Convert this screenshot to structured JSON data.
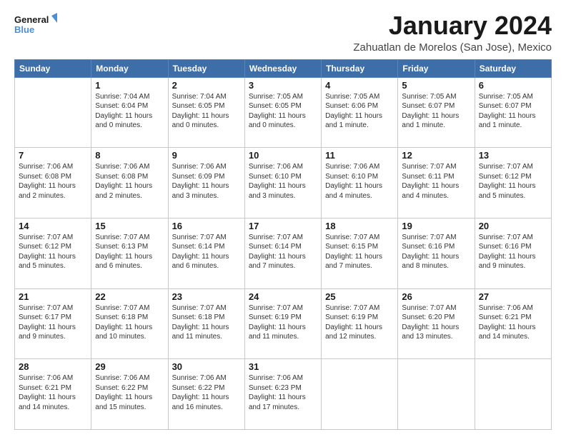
{
  "logo": {
    "line1": "General",
    "line2": "Blue"
  },
  "title": "January 2024",
  "subtitle": "Zahuatlan de Morelos (San Jose), Mexico",
  "days_header": [
    "Sunday",
    "Monday",
    "Tuesday",
    "Wednesday",
    "Thursday",
    "Friday",
    "Saturday"
  ],
  "weeks": [
    [
      {
        "num": "",
        "info": ""
      },
      {
        "num": "1",
        "info": "Sunrise: 7:04 AM\nSunset: 6:04 PM\nDaylight: 11 hours\nand 0 minutes."
      },
      {
        "num": "2",
        "info": "Sunrise: 7:04 AM\nSunset: 6:05 PM\nDaylight: 11 hours\nand 0 minutes."
      },
      {
        "num": "3",
        "info": "Sunrise: 7:05 AM\nSunset: 6:05 PM\nDaylight: 11 hours\nand 0 minutes."
      },
      {
        "num": "4",
        "info": "Sunrise: 7:05 AM\nSunset: 6:06 PM\nDaylight: 11 hours\nand 1 minute."
      },
      {
        "num": "5",
        "info": "Sunrise: 7:05 AM\nSunset: 6:07 PM\nDaylight: 11 hours\nand 1 minute."
      },
      {
        "num": "6",
        "info": "Sunrise: 7:05 AM\nSunset: 6:07 PM\nDaylight: 11 hours\nand 1 minute."
      }
    ],
    [
      {
        "num": "7",
        "info": "Sunrise: 7:06 AM\nSunset: 6:08 PM\nDaylight: 11 hours\nand 2 minutes."
      },
      {
        "num": "8",
        "info": "Sunrise: 7:06 AM\nSunset: 6:08 PM\nDaylight: 11 hours\nand 2 minutes."
      },
      {
        "num": "9",
        "info": "Sunrise: 7:06 AM\nSunset: 6:09 PM\nDaylight: 11 hours\nand 3 minutes."
      },
      {
        "num": "10",
        "info": "Sunrise: 7:06 AM\nSunset: 6:10 PM\nDaylight: 11 hours\nand 3 minutes."
      },
      {
        "num": "11",
        "info": "Sunrise: 7:06 AM\nSunset: 6:10 PM\nDaylight: 11 hours\nand 4 minutes."
      },
      {
        "num": "12",
        "info": "Sunrise: 7:07 AM\nSunset: 6:11 PM\nDaylight: 11 hours\nand 4 minutes."
      },
      {
        "num": "13",
        "info": "Sunrise: 7:07 AM\nSunset: 6:12 PM\nDaylight: 11 hours\nand 5 minutes."
      }
    ],
    [
      {
        "num": "14",
        "info": "Sunrise: 7:07 AM\nSunset: 6:12 PM\nDaylight: 11 hours\nand 5 minutes."
      },
      {
        "num": "15",
        "info": "Sunrise: 7:07 AM\nSunset: 6:13 PM\nDaylight: 11 hours\nand 6 minutes."
      },
      {
        "num": "16",
        "info": "Sunrise: 7:07 AM\nSunset: 6:14 PM\nDaylight: 11 hours\nand 6 minutes."
      },
      {
        "num": "17",
        "info": "Sunrise: 7:07 AM\nSunset: 6:14 PM\nDaylight: 11 hours\nand 7 minutes."
      },
      {
        "num": "18",
        "info": "Sunrise: 7:07 AM\nSunset: 6:15 PM\nDaylight: 11 hours\nand 7 minutes."
      },
      {
        "num": "19",
        "info": "Sunrise: 7:07 AM\nSunset: 6:16 PM\nDaylight: 11 hours\nand 8 minutes."
      },
      {
        "num": "20",
        "info": "Sunrise: 7:07 AM\nSunset: 6:16 PM\nDaylight: 11 hours\nand 9 minutes."
      }
    ],
    [
      {
        "num": "21",
        "info": "Sunrise: 7:07 AM\nSunset: 6:17 PM\nDaylight: 11 hours\nand 9 minutes."
      },
      {
        "num": "22",
        "info": "Sunrise: 7:07 AM\nSunset: 6:18 PM\nDaylight: 11 hours\nand 10 minutes."
      },
      {
        "num": "23",
        "info": "Sunrise: 7:07 AM\nSunset: 6:18 PM\nDaylight: 11 hours\nand 11 minutes."
      },
      {
        "num": "24",
        "info": "Sunrise: 7:07 AM\nSunset: 6:19 PM\nDaylight: 11 hours\nand 11 minutes."
      },
      {
        "num": "25",
        "info": "Sunrise: 7:07 AM\nSunset: 6:19 PM\nDaylight: 11 hours\nand 12 minutes."
      },
      {
        "num": "26",
        "info": "Sunrise: 7:07 AM\nSunset: 6:20 PM\nDaylight: 11 hours\nand 13 minutes."
      },
      {
        "num": "27",
        "info": "Sunrise: 7:06 AM\nSunset: 6:21 PM\nDaylight: 11 hours\nand 14 minutes."
      }
    ],
    [
      {
        "num": "28",
        "info": "Sunrise: 7:06 AM\nSunset: 6:21 PM\nDaylight: 11 hours\nand 14 minutes."
      },
      {
        "num": "29",
        "info": "Sunrise: 7:06 AM\nSunset: 6:22 PM\nDaylight: 11 hours\nand 15 minutes."
      },
      {
        "num": "30",
        "info": "Sunrise: 7:06 AM\nSunset: 6:22 PM\nDaylight: 11 hours\nand 16 minutes."
      },
      {
        "num": "31",
        "info": "Sunrise: 7:06 AM\nSunset: 6:23 PM\nDaylight: 11 hours\nand 17 minutes."
      },
      {
        "num": "",
        "info": ""
      },
      {
        "num": "",
        "info": ""
      },
      {
        "num": "",
        "info": ""
      }
    ]
  ]
}
